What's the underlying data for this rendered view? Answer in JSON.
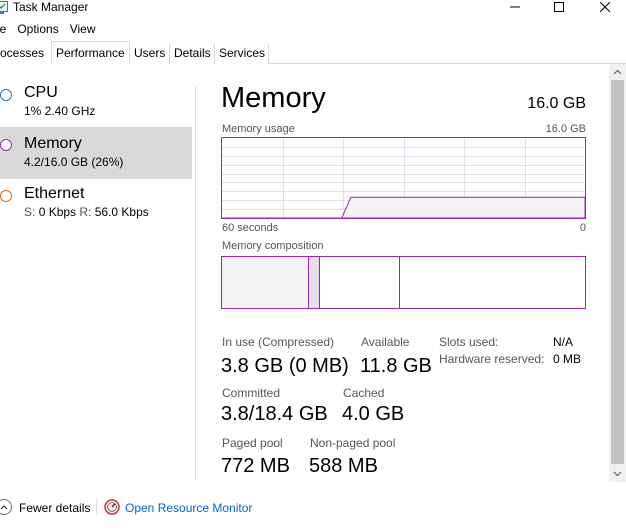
{
  "window": {
    "title": "Task Manager"
  },
  "menu": {
    "file": "le",
    "options": "Options",
    "view": "View"
  },
  "tabs": [
    {
      "label": "ocesses"
    },
    {
      "label": "Performance"
    },
    {
      "label": "Users"
    },
    {
      "label": "Details"
    },
    {
      "label": "Services"
    }
  ],
  "sidebar": {
    "items": [
      {
        "name": "CPU",
        "sub": "1% 2.40 GHz",
        "color": "#1a7cc7"
      },
      {
        "name": "Memory",
        "sub": "4.2/16.0 GB (26%)",
        "color": "#9528b4"
      },
      {
        "name": "Ethernet",
        "sub_send_label": "S:",
        "sub_send": "0 Kbps",
        "sub_recv_label": "R:",
        "sub_recv": "56.0 Kbps",
        "color": "#d96b1c"
      }
    ]
  },
  "memory": {
    "title": "Memory",
    "total": "16.0 GB",
    "usage_label": "Memory usage",
    "usage_max": "16.0 GB",
    "time_left": "60 seconds",
    "time_right": "0",
    "composition_label": "Memory composition",
    "usage_fraction_now": 0.26,
    "composition": {
      "in_use_fraction": 0.24,
      "modified_fraction": 0.03,
      "standby_fraction": 0.22
    }
  },
  "stats": {
    "in_use_label": "In use (Compressed)",
    "in_use_value": "3.8 GB (0 MB)",
    "available_label": "Available",
    "available_value": "11.8 GB",
    "committed_label": "Committed",
    "committed_value": "3.8/18.4 GB",
    "cached_label": "Cached",
    "cached_value": "4.0 GB",
    "paged_label": "Paged pool",
    "paged_value": "772 MB",
    "nonpaged_label": "Non-paged pool",
    "nonpaged_value": "588 MB",
    "slots_label": "Slots used:",
    "slots_value": "N/A",
    "hw_reserved_label": "Hardware reserved:",
    "hw_reserved_value": "0 MB"
  },
  "footer": {
    "fewer_details": "Fewer details",
    "open_resource_monitor": "Open Resource Monitor"
  },
  "colors": {
    "accent": "#9528b4",
    "link": "#0066cc",
    "selected_bg": "#d9d9d9"
  }
}
